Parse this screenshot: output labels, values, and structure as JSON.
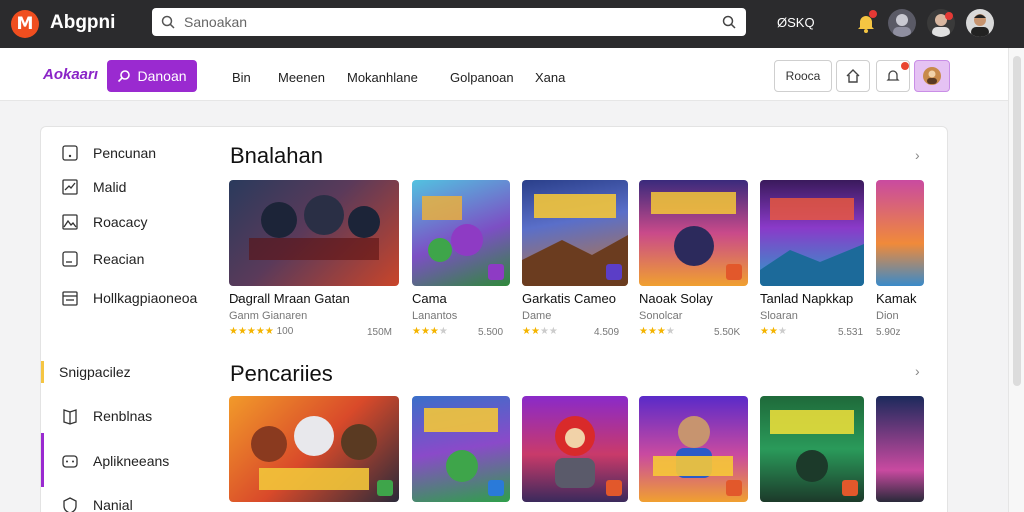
{
  "topbar": {
    "logo_letter": "M",
    "title": "Abgpni",
    "search_placeholder": "Sanoakan",
    "right_text": "ØSKQ"
  },
  "subheader": {
    "brand": "Aokaarı",
    "primary_button": "Danoan",
    "nav": [
      "Bin",
      "Meenen",
      "Mokanhlane",
      "Golpanoan",
      "Xana"
    ],
    "outline_button": "Rooca"
  },
  "sidebar": {
    "top_items": [
      {
        "label": "Pencunan",
        "icon": "square-dot-icon"
      },
      {
        "label": "Malid",
        "icon": "chart-icon"
      },
      {
        "label": "Roacacy",
        "icon": "image-icon"
      },
      {
        "label": "Reacian",
        "icon": "document-icon"
      },
      {
        "label": "Hollkagpiaoneoa",
        "icon": "calendar-icon"
      }
    ],
    "bottom_items": [
      {
        "label": "Snigpacilez",
        "icon": ""
      },
      {
        "label": "Renblnas",
        "icon": "book-icon"
      },
      {
        "label": "Aplikneeans",
        "icon": "gamepad-icon"
      },
      {
        "label": "Nanial",
        "icon": "shield-icon"
      }
    ]
  },
  "sections": [
    {
      "title": "Bnalahan",
      "cards": [
        {
          "title": "Dagrall Mraan Gatan",
          "sub": "Ganm Gianaren",
          "rating": 5,
          "count": "100",
          "num": "150M"
        },
        {
          "title": "Cama",
          "sub": "Lanantos",
          "rating": 3,
          "count": "",
          "num": "5.500"
        },
        {
          "title": "Garkatis Cameo",
          "sub": "Dame",
          "rating": 2,
          "count": "",
          "num": "4.509"
        },
        {
          "title": "Naoak Solay",
          "sub": "Sonolcar",
          "rating": 3,
          "count": "",
          "num": "5.50K"
        },
        {
          "title": "Tanlad Napkkap",
          "sub": "Sloaran",
          "rating": 2,
          "count": "",
          "num": "5.531"
        },
        {
          "title": "Kamak",
          "sub": "Dion",
          "rating": 0,
          "count": "",
          "num": "5.90z"
        }
      ]
    },
    {
      "title": "Pencariies",
      "cards": [
        {
          "title": "",
          "sub": "",
          "rating": 0,
          "count": "",
          "num": ""
        },
        {
          "title": "",
          "sub": "",
          "rating": 0,
          "count": "",
          "num": ""
        },
        {
          "title": "",
          "sub": "",
          "rating": 0,
          "count": "",
          "num": ""
        },
        {
          "title": "",
          "sub": "",
          "rating": 0,
          "count": "",
          "num": ""
        },
        {
          "title": "",
          "sub": "",
          "rating": 0,
          "count": "",
          "num": ""
        },
        {
          "title": "",
          "sub": "",
          "rating": 0,
          "count": "",
          "num": ""
        }
      ]
    }
  ],
  "colors": {
    "accent": "#9a2ad0",
    "topbar": "#2b2b2d",
    "logo": "#f04e1f",
    "star": "#f4b400"
  }
}
